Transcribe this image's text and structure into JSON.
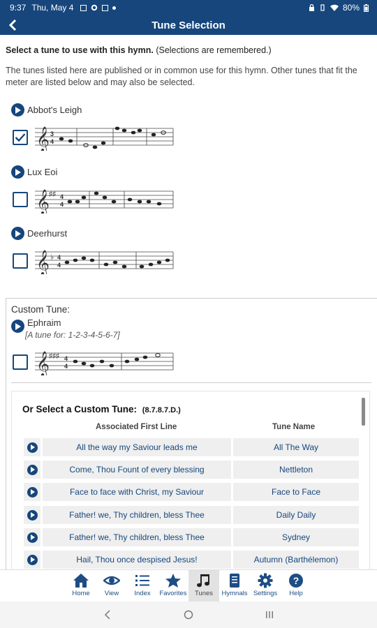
{
  "status": {
    "time": "9:37",
    "date": "Thu, May 4",
    "battery": "80%"
  },
  "header": {
    "title": "Tune Selection"
  },
  "intro": {
    "bold": "Select a tune to use with this hymn.",
    "note": "(Selections are remembered.)",
    "paragraph": "The tunes listed here are published or in common use for this hymn. Other tunes that fit the meter are listed below and may also be selected."
  },
  "tunes": [
    {
      "name": "Abbot's Leigh",
      "checked": true
    },
    {
      "name": "Lux Eoi",
      "checked": false
    },
    {
      "name": "Deerhurst",
      "checked": false
    }
  ],
  "custom": {
    "label": "Custom Tune:",
    "tune_name": "Ephraim",
    "subnote": "[A tune for: 1-2-3-4-5-6-7]",
    "checked": false
  },
  "custom_list": {
    "heading": "Or Select a Custom Tune:",
    "meter": "(8.7.8.7.D.)",
    "col_first_line": "Associated First Line",
    "col_tune_name": "Tune Name",
    "rows": [
      {
        "first_line": "All the way my Saviour leads me",
        "tune": "All The Way"
      },
      {
        "first_line": "Come, Thou Fount of every blessing",
        "tune": "Nettleton"
      },
      {
        "first_line": "Face to face with Christ, my Saviour",
        "tune": "Face to Face"
      },
      {
        "first_line": "Father! we, Thy children, bless Thee",
        "tune": "Daily Daily"
      },
      {
        "first_line": "Father! we, Thy children, bless Thee",
        "tune": "Sydney"
      },
      {
        "first_line": "Hail, Thou once despised Jesus!",
        "tune": "Autumn (Barthélemon)"
      }
    ]
  },
  "tabs": [
    {
      "label": "Home",
      "icon": "home-icon"
    },
    {
      "label": "View",
      "icon": "eye-icon"
    },
    {
      "label": "Index",
      "icon": "list-icon"
    },
    {
      "label": "Favorites",
      "icon": "star-icon"
    },
    {
      "label": "Tunes",
      "icon": "music-note-icon",
      "active": true
    },
    {
      "label": "Hymnals",
      "icon": "book-icon"
    },
    {
      "label": "Settings",
      "icon": "gear-icon"
    },
    {
      "label": "Help",
      "icon": "help-icon"
    }
  ],
  "colors": {
    "brand": "#16467c",
    "row_bg": "#efefef",
    "active_tab_bg": "#e2e2e2"
  }
}
